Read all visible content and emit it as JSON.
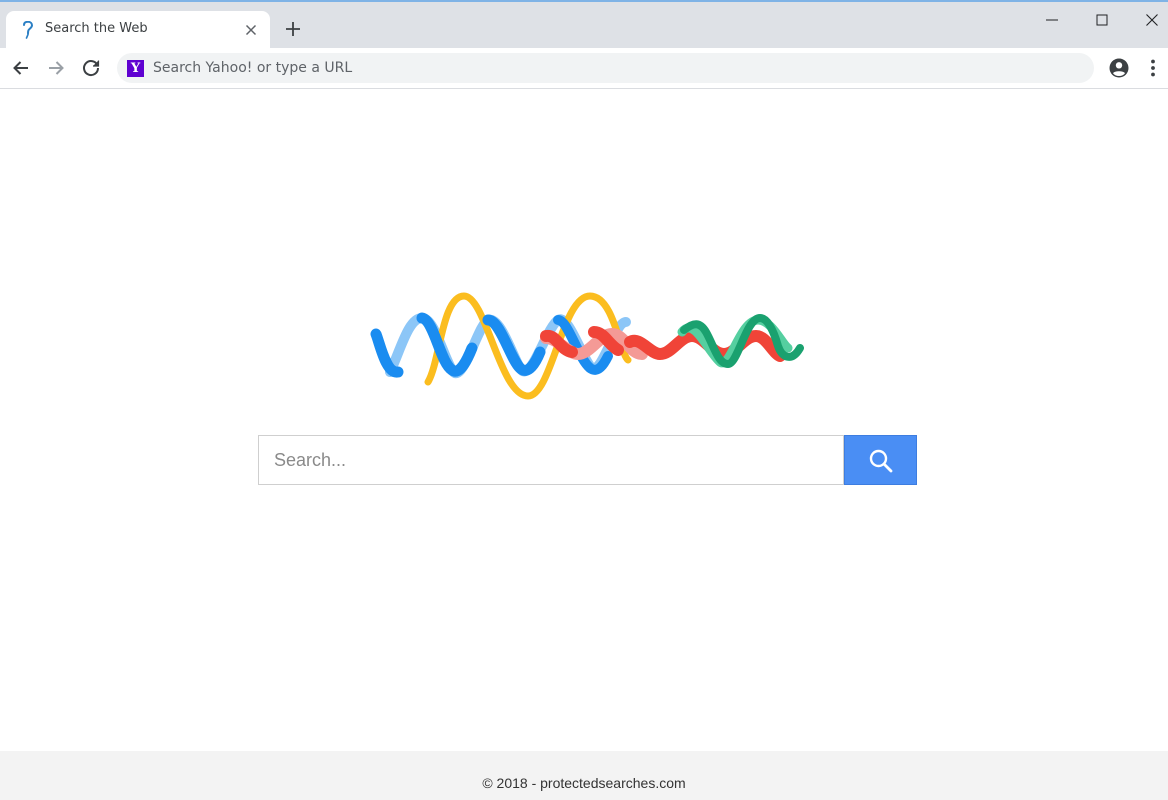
{
  "browser": {
    "tab": {
      "title": "Search the Web",
      "favicon": "question-mark-icon"
    },
    "new_tab_icon": "plus-icon",
    "window_controls": [
      "minimize-icon",
      "maximize-icon",
      "close-icon"
    ],
    "toolbar": {
      "back_icon": "back-arrow-icon",
      "forward_icon": "forward-arrow-icon",
      "reload_icon": "reload-icon",
      "omnibox": {
        "site_icon_letter": "Y",
        "placeholder": "Search Yahoo! or type a URL",
        "value": ""
      },
      "profile_icon": "account-circle-icon",
      "menu_icon": "more-vert-icon"
    }
  },
  "page": {
    "logo": "wave-ribbon-logo",
    "search": {
      "placeholder": "Search...",
      "value": "",
      "button_icon": "search-icon"
    },
    "footer": {
      "copyright": "© 2018 - protectedsearches.com"
    }
  },
  "colors": {
    "search_button": "#4a8ef4",
    "logo_blue": "#1a8cf0",
    "logo_light_blue": "#8cc6f7",
    "logo_yellow": "#fbbd1f",
    "logo_red": "#f04438",
    "logo_pink": "#f49a96",
    "logo_green": "#1aa16f",
    "logo_light_green": "#55cfa0"
  }
}
